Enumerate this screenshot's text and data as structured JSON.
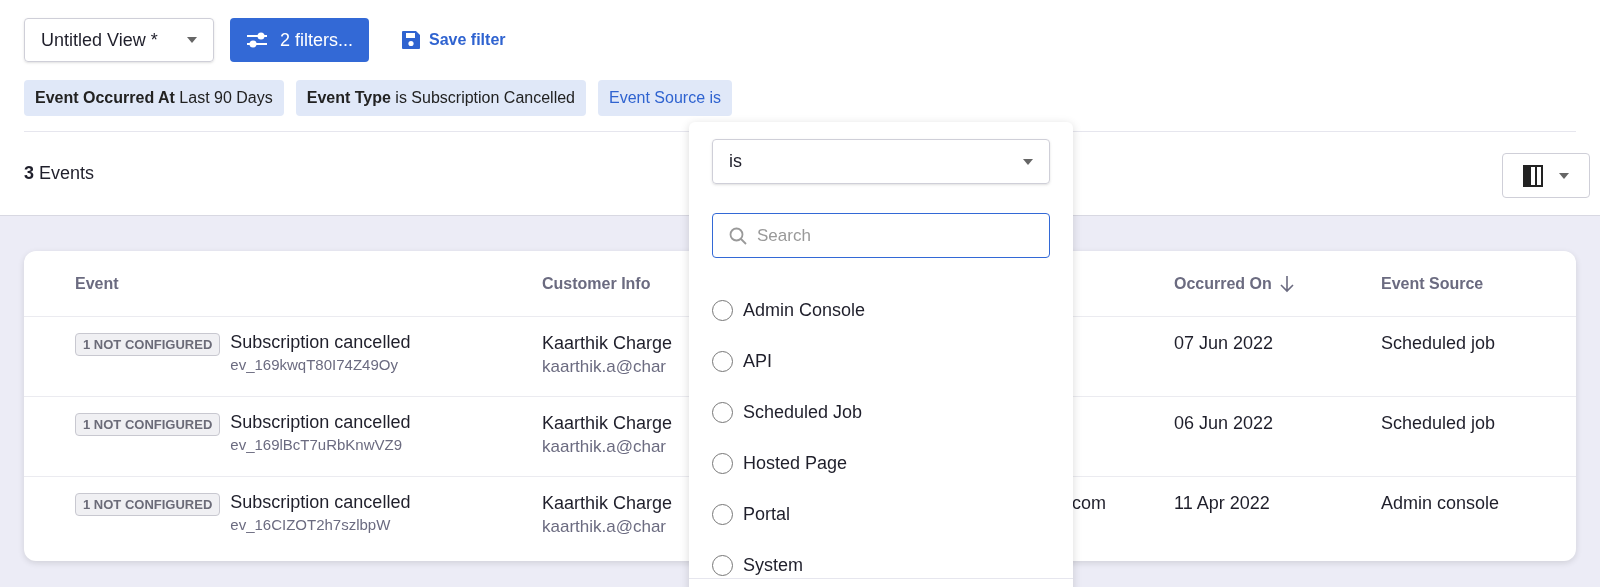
{
  "toolbar": {
    "view_select": "Untitled View *",
    "filters_button": "2 filters...",
    "save_filter": "Save filter"
  },
  "filter_chips": [
    {
      "field": "Event Occurred At",
      "value": "Last 90 Days",
      "active": false
    },
    {
      "field": "Event Type",
      "value": "is Subscription Cancelled",
      "active": false
    },
    {
      "field": "Event Source",
      "value": "is",
      "active": true
    }
  ],
  "summary": {
    "count": "3",
    "label": "Events"
  },
  "table": {
    "columns": [
      {
        "label": "Event",
        "sorted": false
      },
      {
        "label": "Customer Info",
        "sorted": false
      },
      {
        "label": "Occurred On",
        "sorted": true
      },
      {
        "label": "Event Source",
        "sorted": false
      }
    ],
    "rows": [
      {
        "badge": "1 NOT CONFIGURED",
        "event": "Subscription cancelled",
        "event_id": "ev_169kwqT80I74Z49Oy",
        "customer_name": "Kaarthik Charge",
        "customer_email": "kaarthik.a@char",
        "occurred_on": "07 Jun 2022",
        "event_source": "Scheduled job"
      },
      {
        "badge": "1 NOT CONFIGURED",
        "event": "Subscription cancelled",
        "event_id": "ev_169lBcT7uRbKnwVZ9",
        "customer_name": "Kaarthik Charge",
        "customer_email": "kaarthik.a@char",
        "occurred_on": "06 Jun 2022",
        "event_source": "Scheduled job"
      },
      {
        "badge": "1 NOT CONFIGURED",
        "event": "Subscription cancelled",
        "event_id": "ev_16CIZOT2h7szlbpW",
        "customer_name": "Kaarthik Charge",
        "customer_email": "kaarthik.a@char",
        "column_3": "com",
        "occurred_on": "11 Apr 2022",
        "event_source": "Admin console"
      }
    ]
  },
  "dropdown": {
    "operator": "is",
    "search_placeholder": "Search",
    "options": [
      {
        "label": "Admin Console",
        "selected": false
      },
      {
        "label": "API",
        "selected": false
      },
      {
        "label": "Scheduled Job",
        "selected": false
      },
      {
        "label": "Hosted Page",
        "selected": false
      },
      {
        "label": "Portal",
        "selected": false
      },
      {
        "label": "System",
        "selected": false
      }
    ]
  }
}
